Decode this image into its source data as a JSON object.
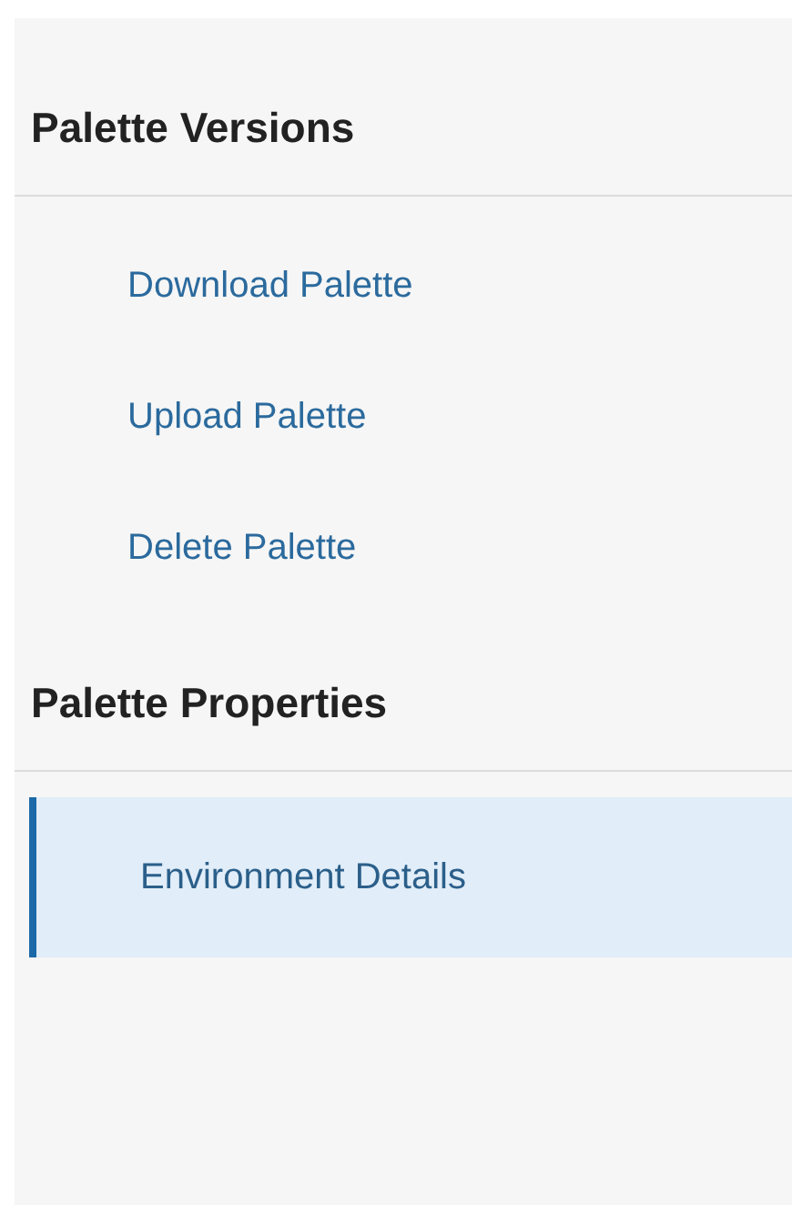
{
  "sections": [
    {
      "title": "Palette Versions",
      "items": [
        {
          "label": "Download Palette",
          "selected": false
        },
        {
          "label": "Upload Palette",
          "selected": false
        },
        {
          "label": "Delete Palette",
          "selected": false
        }
      ]
    },
    {
      "title": "Palette Properties",
      "items": [
        {
          "label": "Environment Details",
          "selected": true
        }
      ]
    }
  ]
}
